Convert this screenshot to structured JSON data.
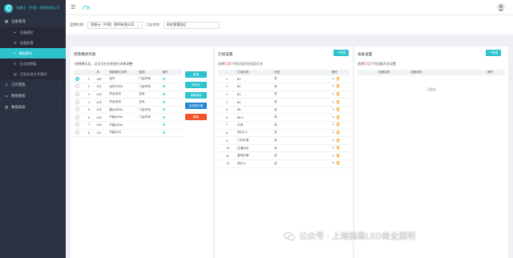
{
  "app": {
    "brand": "宣爵士（中国）照明有限公司"
  },
  "sidebar": {
    "items": [
      {
        "label": "设备管理",
        "icon": "grid-icon",
        "expanded": true
      },
      {
        "label": "设备模控",
        "sub": true,
        "icon": "bulb-icon"
      },
      {
        "label": "设备配置",
        "sub": true,
        "icon": "wrench-icon"
      },
      {
        "label": "模拟模式",
        "sub": true,
        "active": true,
        "icon": "sliders-icon"
      },
      {
        "label": "日动定期值",
        "sub": true,
        "icon": "refresh-icon"
      },
      {
        "label": "灯机及其文字管控",
        "sub": true,
        "icon": "doc-icon"
      },
      {
        "label": "工作营收",
        "icon": "user-icon"
      },
      {
        "label": "数据看板",
        "icon": "monitor-icon"
      },
      {
        "label": "数据报表",
        "icon": "table-icon"
      }
    ]
  },
  "filter": {
    "store_label": "品牌名称:",
    "store_value": "宣爵士（中国）照明有限公司",
    "door_label": "门店名称:",
    "door_value": "彩虹智慧园汇"
  },
  "panel1": {
    "title": "场景模式列表",
    "hint_prefix": "*选择模式后，点击可在左侧进行场景调整",
    "headers": [
      "",
      "序",
      "场景模式名称",
      "描述",
      "操作"
    ],
    "rows": [
      {
        "n": "1",
        "id": "100",
        "name": "全开",
        "desc": "门店开场",
        "on": true
      },
      {
        "n": "2",
        "id": "101",
        "name": "全开(75%)",
        "desc": "门店开场",
        "on": false
      },
      {
        "n": "3",
        "id": "102",
        "name": "开全关闭",
        "desc": "全关",
        "on": false
      },
      {
        "n": "4",
        "id": "103",
        "name": "开全关闭",
        "desc": "全关",
        "on": false
      },
      {
        "n": "5",
        "id": "104",
        "name": "展示(60%)",
        "desc": "门店开场",
        "on": false
      },
      {
        "n": "6",
        "id": "105",
        "name": "节能(50%)",
        "desc": "门店开场",
        "on": false
      },
      {
        "n": "7",
        "id": "106",
        "name": "节能(30%)",
        "desc": "",
        "on": false
      },
      {
        "n": "8",
        "id": "107",
        "name": "节能(0%)",
        "desc": "",
        "on": false
      }
    ],
    "actions": [
      {
        "label": "新增",
        "color": "#2cc3cf"
      },
      {
        "label": "修改名",
        "color": "#2cc3cf"
      },
      {
        "label": "场景保存",
        "color": "#2cc3cf"
      },
      {
        "label": "应用到灯组",
        "color": "#2488d8"
      },
      {
        "label": "删除",
        "color": "#f2552c"
      }
    ]
  },
  "panel2": {
    "title": "灯组设置",
    "btn": "+ 新增",
    "hint_prefix": "选择",
    "hint_red": "灯具",
    "hint_suffix": "下列灯组开启设定灯光",
    "headers": [
      "",
      "灯组名称",
      "状态",
      "",
      "操作"
    ],
    "rows": [
      {
        "n": "1",
        "name": "B1",
        "state": "关"
      },
      {
        "n": "2",
        "name": "B2",
        "state": "关"
      },
      {
        "n": "3",
        "name": "B3",
        "state": "关"
      },
      {
        "n": "4",
        "name": "B4",
        "state": "关"
      },
      {
        "n": "5",
        "name": "B5",
        "state": "关"
      },
      {
        "n": "6",
        "name": "B6-2",
        "state": "关"
      },
      {
        "n": "7",
        "name": "灯带",
        "state": "关"
      },
      {
        "n": "8",
        "name": "吊灯4-4",
        "state": "关"
      },
      {
        "n": "9",
        "name": "门口灯带",
        "state": "关"
      },
      {
        "n": "10",
        "name": "过道天花",
        "state": "关"
      },
      {
        "n": "11",
        "name": "室内灯带",
        "state": "关"
      },
      {
        "n": "12",
        "name": "吊灯-4",
        "state": "关"
      }
    ]
  },
  "panel3": {
    "title": "设备设置",
    "btn": "+ 新增",
    "hint_prefix": "选择",
    "hint_red": "灯组",
    "hint_suffix": "下列设备开关设置",
    "headers": [
      "",
      "设备名称",
      "设备状态",
      "",
      "操作"
    ],
    "empty": "无数据"
  },
  "watermark": {
    "text": "公众号 · 上海鸽恩LED商业照明"
  }
}
